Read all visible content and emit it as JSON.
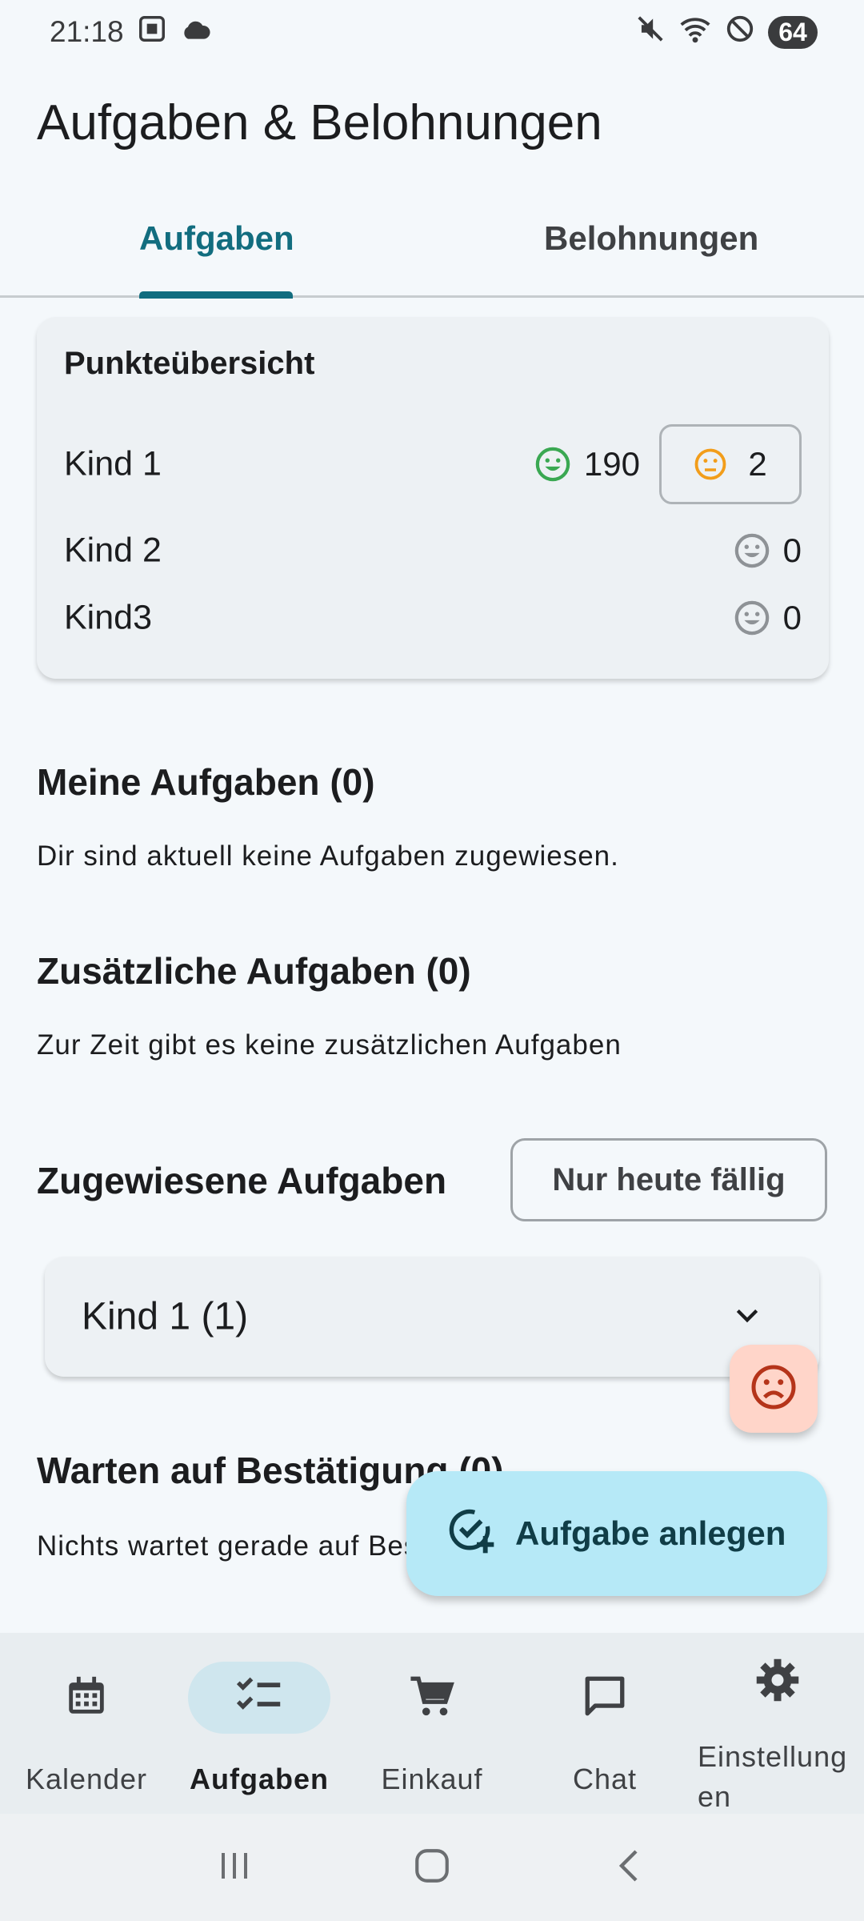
{
  "status_bar": {
    "time": "21:18",
    "battery": "64"
  },
  "app_title": "Aufgaben & Belohnungen",
  "tabs": [
    {
      "label": "Aufgaben",
      "active": true
    },
    {
      "label": "Belohnungen",
      "active": false
    }
  ],
  "points_card": {
    "title": "Punkteübersicht",
    "kids": [
      {
        "name": "Kind 1",
        "good_points": "190",
        "bad_points": "2"
      },
      {
        "name": "Kind 2",
        "good_points": "0"
      },
      {
        "name": "Kind3",
        "good_points": "0"
      }
    ]
  },
  "sections": {
    "my_tasks": {
      "title": "Meine Aufgaben (0)",
      "text": "Dir sind aktuell keine Aufgaben zugewiesen."
    },
    "extra_tasks": {
      "title": "Zusätzliche Aufgaben (0)",
      "text": "Zur Zeit gibt es keine zusätzlichen Aufgaben"
    },
    "assigned_tasks": {
      "title": "Zugewiesene Aufgaben",
      "filter_label": "Nur heute fällig",
      "group_label": "Kind 1 (1)"
    },
    "awaiting": {
      "title": "Warten auf Bestätigung (0)",
      "text": "Nichts wartet gerade auf Bestätigung."
    }
  },
  "fab": {
    "label": "Aufgabe anlegen"
  },
  "bottom_nav": [
    {
      "label": "Kalender",
      "icon": "calendar-icon"
    },
    {
      "label": "Aufgaben",
      "icon": "checklist-icon",
      "active": true
    },
    {
      "label": "Einkauf",
      "icon": "cart-icon"
    },
    {
      "label": "Chat",
      "icon": "chat-icon"
    },
    {
      "label": "Einstellungen",
      "icon": "gear-icon"
    }
  ],
  "colors": {
    "accent": "#126d7f",
    "good_smiley": "#3aa852",
    "bad_smiley": "#f29d1a",
    "neutral_smiley": "#8e9296",
    "fab_bg": "#b6e9f7",
    "sad_fab_bg": "#ffd5c9"
  }
}
